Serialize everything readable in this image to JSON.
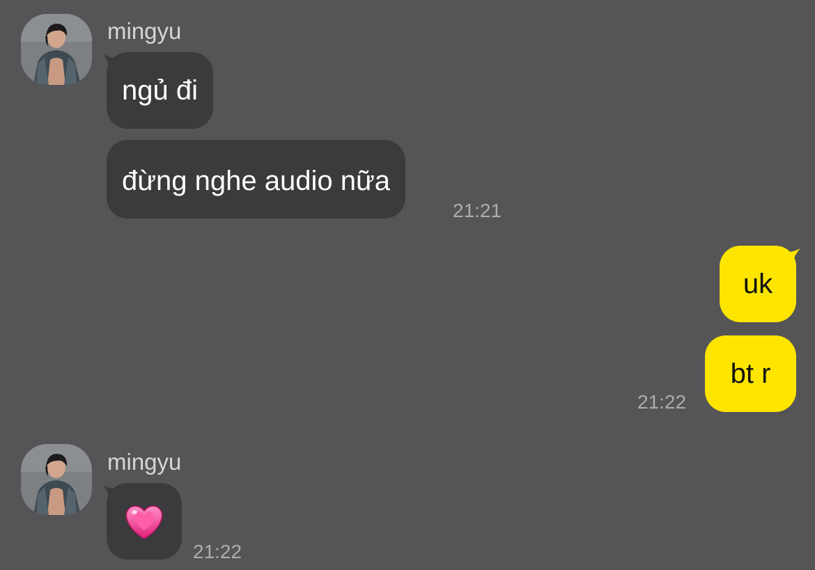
{
  "chat": {
    "messages": [
      {
        "direction": "incoming",
        "sender": "mingyu",
        "texts": [
          "ngủ đi",
          "đừng nghe audio nữa"
        ],
        "time": "21:21"
      },
      {
        "direction": "outgoing",
        "texts": [
          "uk",
          "bt r"
        ],
        "time": "21:22"
      },
      {
        "direction": "incoming",
        "sender": "mingyu",
        "content": "heart-emoji",
        "time": "21:22"
      }
    ]
  },
  "colors": {
    "background": "#555456",
    "incoming_bubble": "#3b3a3d",
    "outgoing_bubble": "#fde500",
    "timestamp": "#adadad"
  }
}
